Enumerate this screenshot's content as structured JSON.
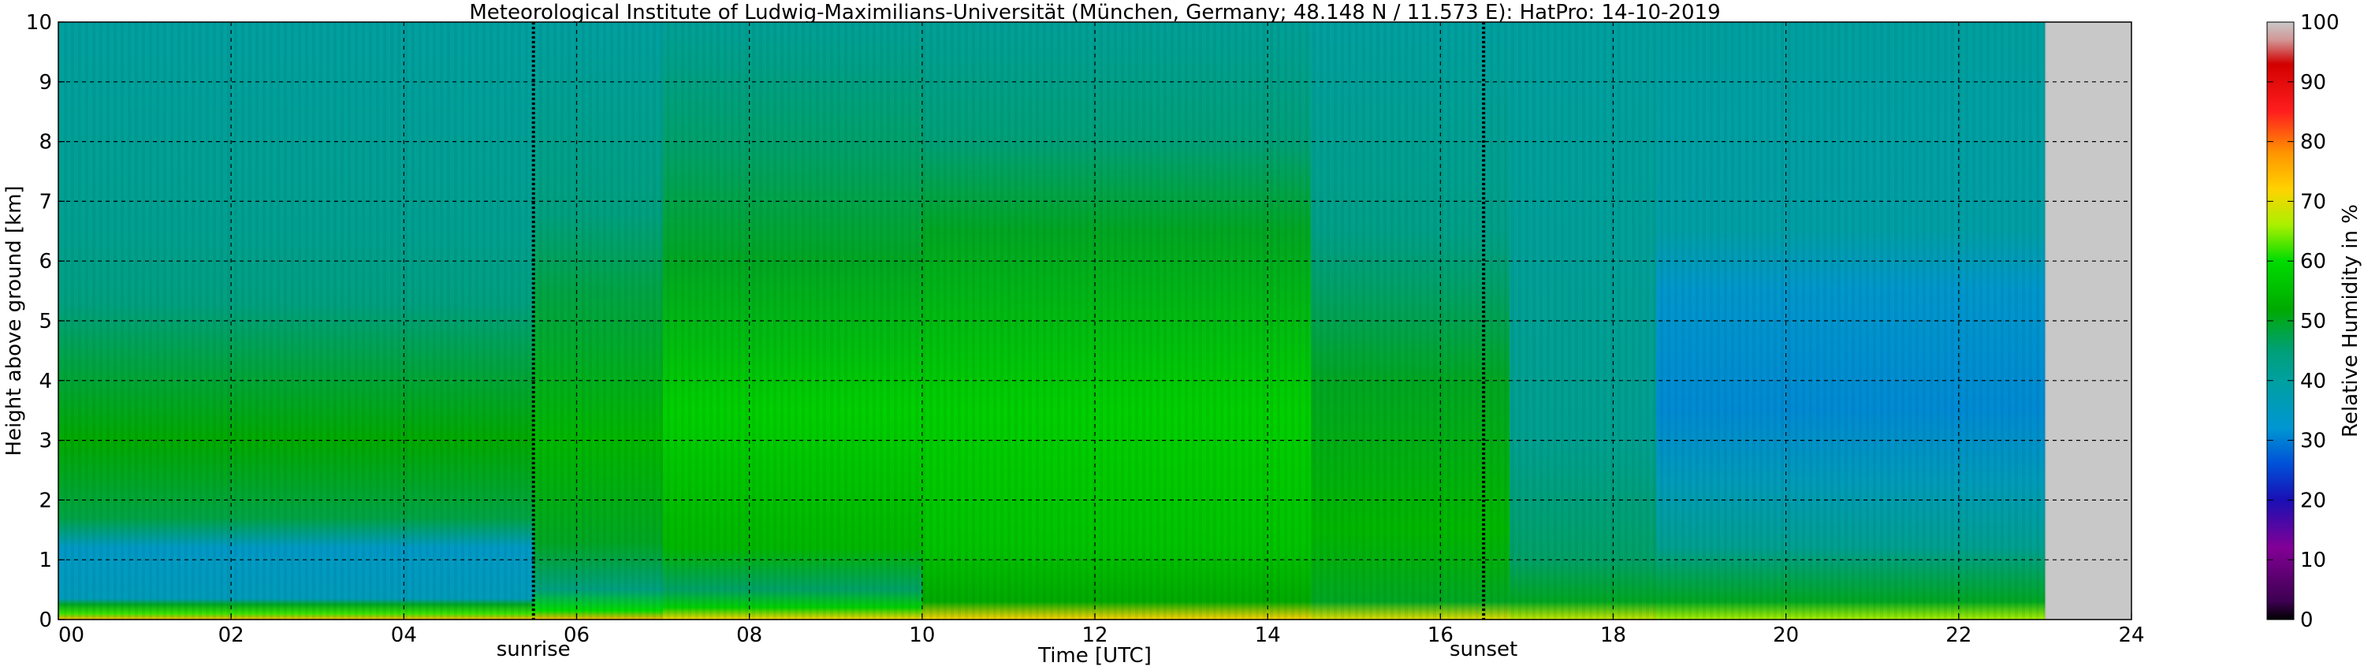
{
  "chart_data": {
    "type": "heatmap",
    "title": "Meteorological Institute of Ludwig-Maximilians-Universität (München, Germany; 48.148 N / 11.573 E):    HatPro: 14-10-2019",
    "xlabel": "Time [UTC]",
    "ylabel": "Height above ground [km]",
    "xlim": [
      0,
      24
    ],
    "ylim": [
      0,
      10
    ],
    "xticks": [
      "00",
      "02",
      "04",
      "06",
      "08",
      "10",
      "12",
      "14",
      "16",
      "18",
      "20",
      "22",
      "24"
    ],
    "yticks": [
      "0",
      "1",
      "2",
      "3",
      "4",
      "5",
      "6",
      "7",
      "8",
      "9",
      "10"
    ],
    "grid": true,
    "data_end_hour": 23.0,
    "no_data_color": "#c8c8c8",
    "events": [
      {
        "label": "sunrise",
        "hour": 5.5
      },
      {
        "label": "sunset",
        "hour": 16.5
      }
    ],
    "colorbar": {
      "label": "Relative Humidity in %",
      "min": 0,
      "max": 100,
      "ticks": [
        "0",
        "10",
        "20",
        "30",
        "40",
        "50",
        "60",
        "70",
        "80",
        "90",
        "100"
      ],
      "stops": [
        {
          "value": 0,
          "color": "#000000"
        },
        {
          "value": 3,
          "color": "#3c0050"
        },
        {
          "value": 12,
          "color": "#820096"
        },
        {
          "value": 20,
          "color": "#1a0fb4"
        },
        {
          "value": 26,
          "color": "#0050d8"
        },
        {
          "value": 32,
          "color": "#0096d2"
        },
        {
          "value": 40,
          "color": "#00a0a0"
        },
        {
          "value": 45,
          "color": "#00a078"
        },
        {
          "value": 52,
          "color": "#00aa00"
        },
        {
          "value": 60,
          "color": "#00dc00"
        },
        {
          "value": 66,
          "color": "#aaf000"
        },
        {
          "value": 72,
          "color": "#ffd200"
        },
        {
          "value": 78,
          "color": "#ff9600"
        },
        {
          "value": 85,
          "color": "#ff1e1e"
        },
        {
          "value": 93,
          "color": "#d20000"
        },
        {
          "value": 97,
          "color": "#d29696"
        },
        {
          "value": 100,
          "color": "#c8c8c8"
        }
      ]
    },
    "profiles": [
      {
        "from": 0.0,
        "to": 5.5,
        "levels": [
          {
            "h": 0.0,
            "rh": 75
          },
          {
            "h": 0.1,
            "rh": 62
          },
          {
            "h": 0.25,
            "rh": 50
          },
          {
            "h": 0.35,
            "rh": 36
          },
          {
            "h": 1.2,
            "rh": 34
          },
          {
            "h": 1.7,
            "rh": 48
          },
          {
            "h": 3.0,
            "rh": 52
          },
          {
            "h": 4.3,
            "rh": 48
          },
          {
            "h": 5.3,
            "rh": 44
          },
          {
            "h": 6.5,
            "rh": 42
          },
          {
            "h": 10.0,
            "rh": 40
          }
        ]
      },
      {
        "from": 5.5,
        "to": 7.0,
        "levels": [
          {
            "h": 0.0,
            "rh": 75
          },
          {
            "h": 0.15,
            "rh": 60
          },
          {
            "h": 0.5,
            "rh": 44
          },
          {
            "h": 1.3,
            "rh": 50
          },
          {
            "h": 3.0,
            "rh": 54
          },
          {
            "h": 5.5,
            "rh": 48
          },
          {
            "h": 6.8,
            "rh": 44
          },
          {
            "h": 10.0,
            "rh": 40
          }
        ]
      },
      {
        "from": 7.0,
        "to": 10.0,
        "levels": [
          {
            "h": 0.0,
            "rh": 72
          },
          {
            "h": 0.2,
            "rh": 58
          },
          {
            "h": 0.5,
            "rh": 46
          },
          {
            "h": 1.2,
            "rh": 54
          },
          {
            "h": 3.5,
            "rh": 58
          },
          {
            "h": 6.0,
            "rh": 50
          },
          {
            "h": 7.8,
            "rh": 46
          },
          {
            "h": 10.0,
            "rh": 41
          }
        ]
      },
      {
        "from": 10.0,
        "to": 14.5,
        "levels": [
          {
            "h": 0.0,
            "rh": 72
          },
          {
            "h": 0.3,
            "rh": 52
          },
          {
            "h": 1.2,
            "rh": 56
          },
          {
            "h": 3.5,
            "rh": 58
          },
          {
            "h": 6.5,
            "rh": 50
          },
          {
            "h": 8.0,
            "rh": 45
          },
          {
            "h": 10.0,
            "rh": 41
          }
        ]
      },
      {
        "from": 14.5,
        "to": 16.8,
        "levels": [
          {
            "h": 0.0,
            "rh": 70
          },
          {
            "h": 0.3,
            "rh": 50
          },
          {
            "h": 1.5,
            "rh": 54
          },
          {
            "h": 4.0,
            "rh": 50
          },
          {
            "h": 5.5,
            "rh": 46
          },
          {
            "h": 6.5,
            "rh": 43
          },
          {
            "h": 10.0,
            "rh": 40
          }
        ]
      },
      {
        "from": 16.8,
        "to": 18.5,
        "levels": [
          {
            "h": 0.0,
            "rh": 68
          },
          {
            "h": 0.3,
            "rh": 50
          },
          {
            "h": 1.0,
            "rh": 46
          },
          {
            "h": 3.0,
            "rh": 42
          },
          {
            "h": 6.0,
            "rh": 41
          },
          {
            "h": 10.0,
            "rh": 40
          }
        ]
      },
      {
        "from": 18.5,
        "to": 23.0,
        "levels": [
          {
            "h": 0.0,
            "rh": 66
          },
          {
            "h": 0.3,
            "rh": 50
          },
          {
            "h": 1.2,
            "rh": 42
          },
          {
            "h": 2.3,
            "rh": 36
          },
          {
            "h": 3.5,
            "rh": 31
          },
          {
            "h": 5.5,
            "rh": 33
          },
          {
            "h": 6.5,
            "rh": 39
          },
          {
            "h": 10.0,
            "rh": 40
          }
        ]
      }
    ]
  }
}
